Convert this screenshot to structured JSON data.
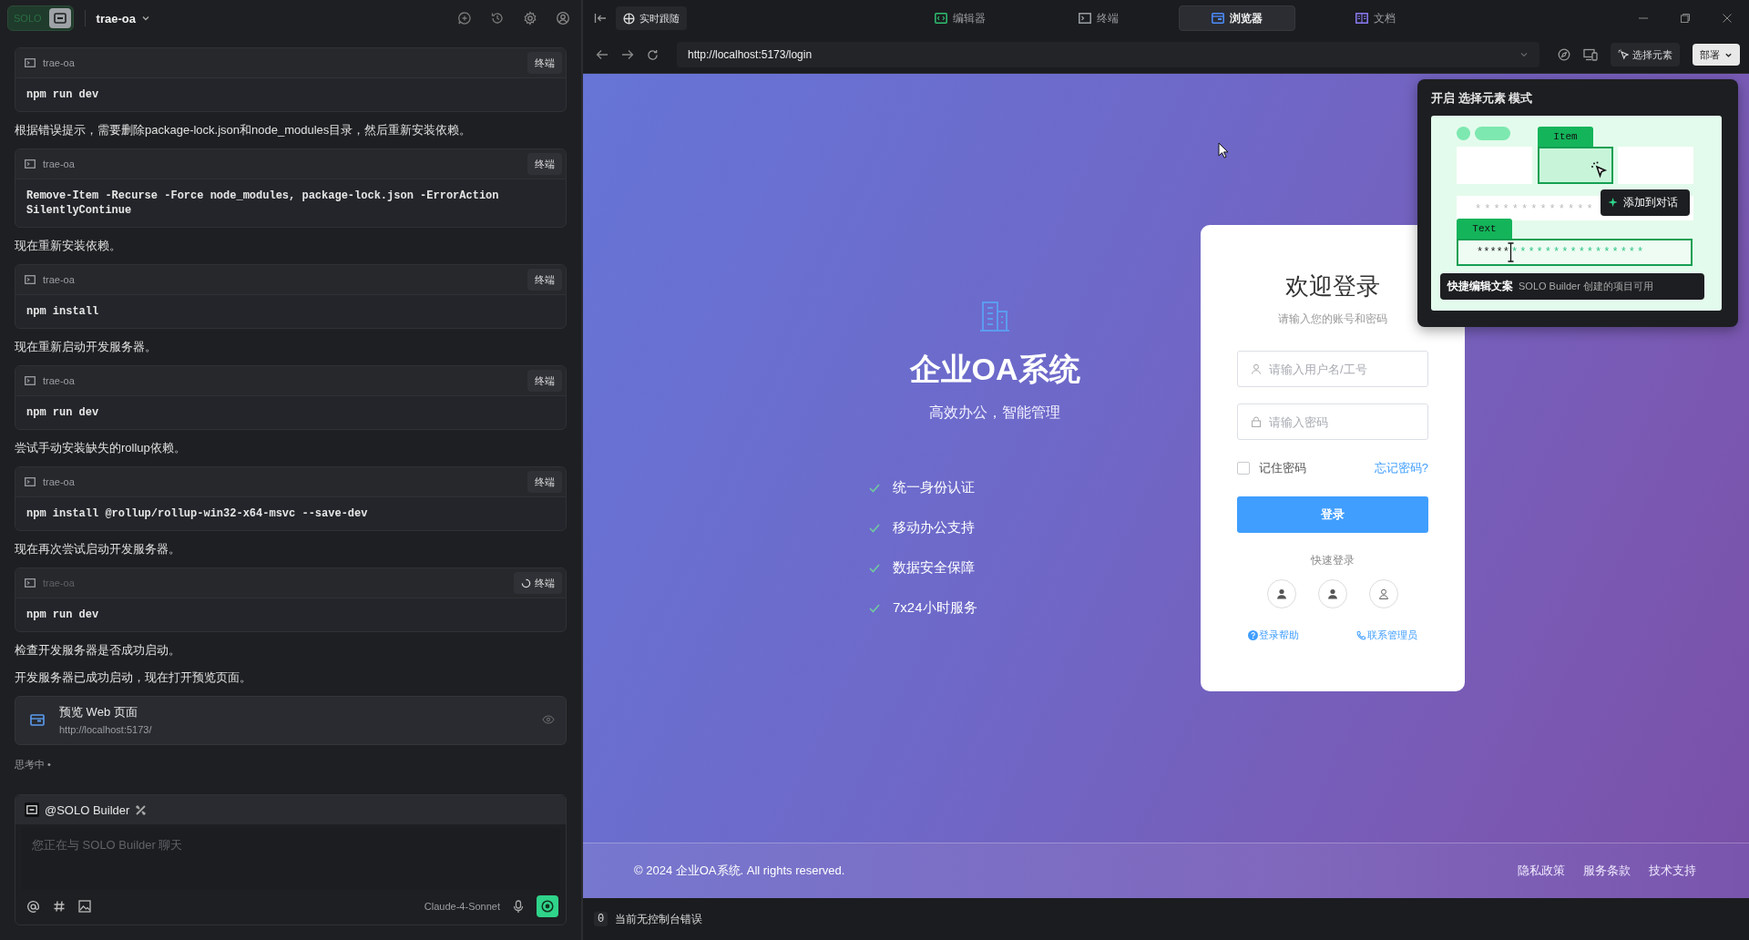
{
  "app": {
    "logo": "SOLO",
    "project": "trae-oa"
  },
  "chat": {
    "items": [
      {
        "kind": "command",
        "workspace": "trae-oa",
        "action": "终端",
        "command": "npm run dev",
        "running": false
      },
      {
        "kind": "message",
        "text": "根据错误提示，需要删除package-lock.json和node_modules目录，然后重新安装依赖。"
      },
      {
        "kind": "command",
        "workspace": "trae-oa",
        "action": "终端",
        "command": "Remove-Item -Recurse -Force node_modules, package-lock.json -ErrorAction SilentlyContinue",
        "running": false
      },
      {
        "kind": "message",
        "text": "现在重新安装依赖。"
      },
      {
        "kind": "command",
        "workspace": "trae-oa",
        "action": "终端",
        "command": "npm install",
        "running": false
      },
      {
        "kind": "message",
        "text": "现在重新启动开发服务器。"
      },
      {
        "kind": "command",
        "workspace": "trae-oa",
        "action": "终端",
        "command": "npm run dev",
        "running": false
      },
      {
        "kind": "message",
        "text": "尝试手动安装缺失的rollup依赖。"
      },
      {
        "kind": "command",
        "workspace": "trae-oa",
        "action": "终端",
        "command": "npm install @rollup/rollup-win32-x64-msvc --save-dev",
        "running": false
      },
      {
        "kind": "message",
        "text": "现在再次尝试启动开发服务器。"
      },
      {
        "kind": "command",
        "workspace": "trae-oa",
        "action": "终端",
        "command": "npm run dev",
        "running": true
      },
      {
        "kind": "message",
        "text": "检查开发服务器是否成功启动。"
      },
      {
        "kind": "message",
        "text": "开发服务器已成功启动，现在打开预览页面。"
      },
      {
        "kind": "preview",
        "title": "预览 Web 页面",
        "url": "http://localhost:5173/"
      }
    ],
    "status": "思考中 •",
    "composer": {
      "agent": "@SOLO Builder",
      "placeholder": "您正在与 SOLO Builder 聊天",
      "model": "Claude-4-Sonnet"
    }
  },
  "toolbar": {
    "follow": "实时跟随",
    "tabs": [
      {
        "label": "编辑器",
        "selected": false
      },
      {
        "label": "终端",
        "selected": false
      },
      {
        "label": "浏览器",
        "selected": true
      },
      {
        "label": "文档",
        "selected": false
      }
    ]
  },
  "browser": {
    "url": "http://localhost:5173/login",
    "select_element": "选择元素",
    "deploy": "部署"
  },
  "page": {
    "hero": {
      "title": "企业OA系统",
      "subtitle": "高效办公，智能管理",
      "features": [
        "统一身份认证",
        "移动办公支持",
        "数据安全保障",
        "7x24小时服务"
      ]
    },
    "login": {
      "title": "欢迎登录",
      "subtitle": "请输入您的账号和密码",
      "username_placeholder": "请输入用户名/工号",
      "password_placeholder": "请输入密码",
      "remember": {
        "label": "记住密码",
        "checked": false
      },
      "forgot": "忘记密码?",
      "submit": "登录",
      "quick_title": "快速登录",
      "help": "登录帮助",
      "contact": "联系管理员"
    },
    "footer": {
      "copyright": "© 2024 企业OA系统. All rights reserved.",
      "links": [
        "隐私政策",
        "服务条款",
        "技术支持"
      ]
    }
  },
  "popover": {
    "title": "开启 **选择元素** 模式",
    "item_tag": "Item",
    "add_badge": "添加到对话",
    "hidden_stars": "*************",
    "text_tag": "Text",
    "typed_stars": "*****",
    "pending_stars": "****************",
    "tooltip_title": "快捷编辑文案",
    "tooltip_note": "SOLO Builder 创建的项目可用"
  },
  "console": {
    "count": "0",
    "message": "当前无控制台错误"
  }
}
